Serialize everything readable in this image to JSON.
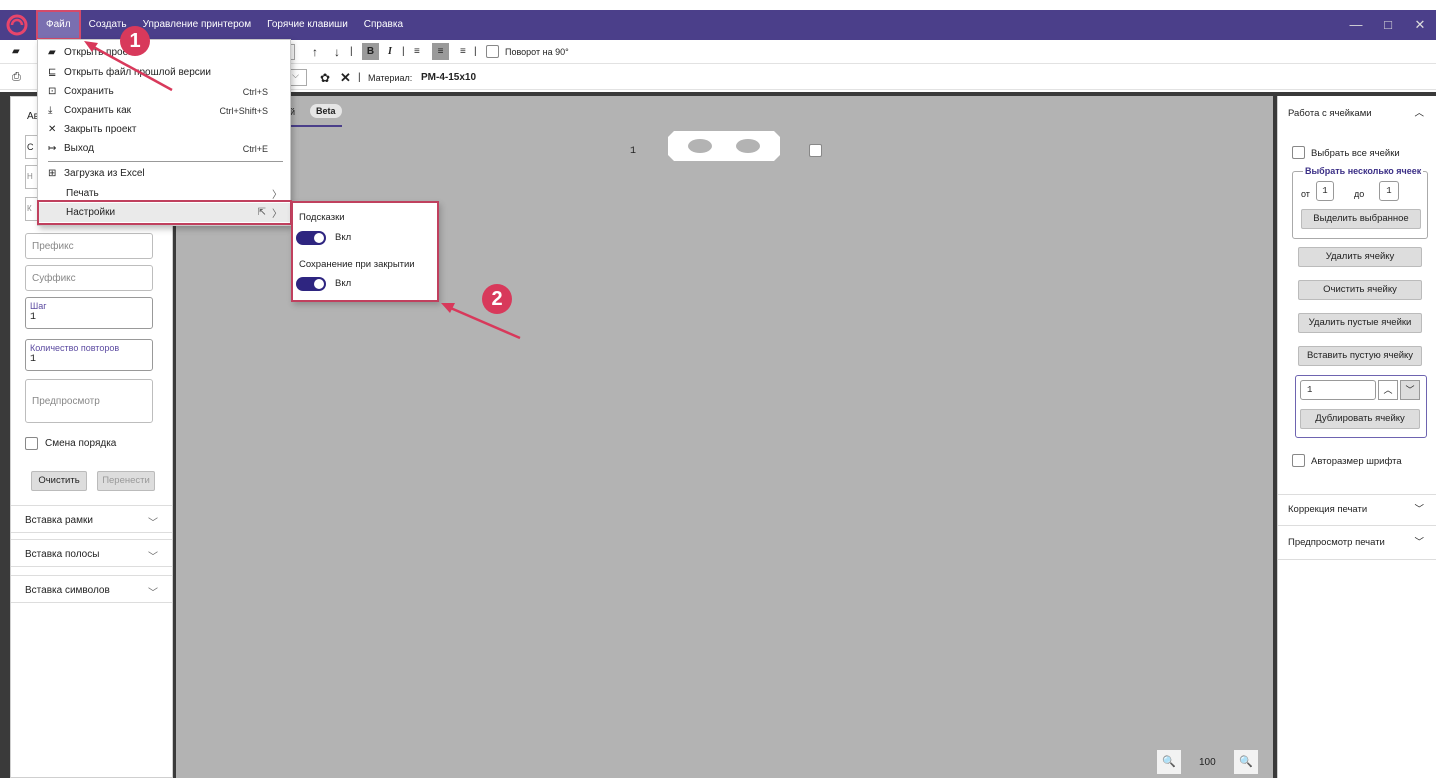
{
  "menubar": {
    "items": [
      "Файл",
      "Создать",
      "Управление принтером",
      "Горячие клавиши",
      "Справка"
    ],
    "window_controls": [
      "—",
      "□",
      "✕"
    ]
  },
  "toolbar1": {
    "rotate_label": "Поворот на 90°",
    "bold": "B",
    "italic": "I"
  },
  "toolbar2": {
    "material_label": "Материал:",
    "material_value": "PM-4-15x10"
  },
  "file_menu": {
    "items": [
      {
        "label": "Открыть проект",
        "shortcut": "",
        "icon": "folder-icon"
      },
      {
        "label": "Открыть файл прошлой версии",
        "shortcut": "",
        "icon": "legacy-file-icon"
      },
      {
        "label": "Сохранить",
        "shortcut": "Ctrl+S",
        "icon": "save-icon"
      },
      {
        "label": "Сохранить как",
        "shortcut": "Ctrl+Shift+S",
        "icon": "download-icon"
      },
      {
        "label": "Закрыть проект",
        "shortcut": "",
        "icon": "close-icon"
      },
      {
        "label": "Выход",
        "shortcut": "Ctrl+E",
        "icon": "exit-icon"
      },
      {
        "label": "Загрузка из Excel",
        "shortcut": "",
        "icon": "table-icon"
      },
      {
        "label": "Печать",
        "shortcut": "",
        "icon": ""
      },
      {
        "label": "Настройки",
        "shortcut": "",
        "icon": ""
      }
    ]
  },
  "settings_submenu": {
    "hints_label": "Подсказки",
    "hints_state": "Вкл",
    "save_on_close_label": "Сохранение при закрытии",
    "save_on_close_state": "Вкл"
  },
  "left_panel": {
    "tab_abbrev": "Ав",
    "prefix_placeholder": "Префикс",
    "suffix_placeholder": "Суффикс",
    "step_label": "Шаг",
    "step_value": "1",
    "repeat_label": "Количество повторов",
    "repeat_value": "1",
    "preview_placeholder": "Предпросмотр",
    "order_change_label": "Смена порядка",
    "clear_button": "Очистить",
    "move_button": "Перенести",
    "accordions": [
      "Вставка рамки",
      "Вставка полосы",
      "Вставка символов"
    ]
  },
  "canvas": {
    "tab_partial": "ой",
    "beta_badge": "Beta",
    "cell_number": "1",
    "zoom_value": "100"
  },
  "right_panel": {
    "cells_section_title": "Работа с ячейками",
    "select_all_label": "Выбрать все ячейки",
    "select_several_label": "Выбрать несколько ячеек",
    "from_label": "от",
    "from_value": "1",
    "to_label": "до",
    "to_value": "1",
    "select_selected_button": "Выделить выбранное",
    "delete_cell_button": "Удалить ячейку",
    "clear_cell_button": "Очистить ячейку",
    "delete_empty_button": "Удалить пустые ячейки",
    "insert_empty_button": "Вставить пустую ячейку",
    "duplicate_count": "1",
    "duplicate_button": "Дублировать ячейку",
    "autosize_label": "Авторазмер шрифта",
    "print_correction_title": "Коррекция печати",
    "print_preview_title": "Предпросмотр печати"
  },
  "callouts": [
    "1",
    "2"
  ],
  "colors": {
    "accent": "#4b3f8a",
    "highlight": "#c0405e",
    "toggle": "#2e2580"
  }
}
